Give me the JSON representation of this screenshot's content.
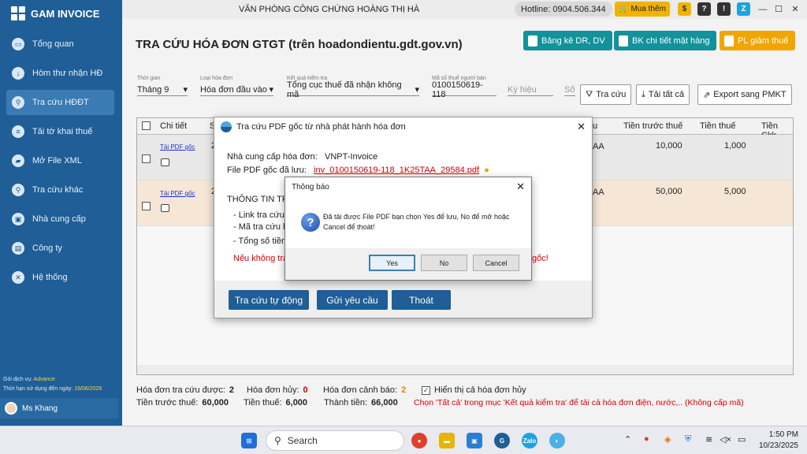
{
  "app": {
    "name": "GAM INVOICE"
  },
  "sidebar": {
    "items": [
      {
        "label": "Tổng quan",
        "icon": "monitor-icon"
      },
      {
        "label": "Hòm thư nhận HĐ",
        "icon": "inbox-icon"
      },
      {
        "label": "Tra cứu HĐĐT",
        "icon": "search-invoice-icon"
      },
      {
        "label": "Tải tờ khai thuế",
        "icon": "tax-form-icon"
      },
      {
        "label": "Mở File XML",
        "icon": "folder-icon"
      },
      {
        "label": "Tra cứu khác",
        "icon": "search-icon"
      },
      {
        "label": "Nhà cung cấp",
        "icon": "supplier-icon"
      },
      {
        "label": "Công ty",
        "icon": "company-icon"
      },
      {
        "label": "Hệ thống",
        "icon": "tools-icon"
      }
    ],
    "plan_label": "Gói dịch vụ:",
    "plan_value": "Advance",
    "expiry_label": "Thời hạn sử dụng đến ngày:",
    "expiry_value": "16/06/2026",
    "user": "Ms Khang"
  },
  "topbar": {
    "office": "VĂN PHÒNG CÔNG CHỨNG HOÀNG THỊ HÀ",
    "hotline": "Hotline: 0904.506.344",
    "buy_more": "Mua thêm"
  },
  "page": {
    "title": "TRA CỨU HÓA ĐƠN GTGT (trên hoadondientu.gdt.gov.vn)",
    "buttons": {
      "bk_dr": "Bảng kê DR, DV",
      "bk_items": "BK chi tiết mặt hàng",
      "pl_tax": "PL giảm thuế"
    }
  },
  "filters": {
    "period_label": "Thời gian",
    "period_value": "Tháng 9",
    "type_label": "Loại hóa đơn",
    "type_value": "Hóa đơn đầu vào",
    "result_label": "Kết quả kiểm tra",
    "result_value": "Tổng cục thuế đã nhận không mã",
    "taxid_label": "Mã số thuế người bán",
    "taxid_value": "0100150619-118",
    "symbol_placeholder": "Ký hiệu",
    "number_placeholder": "Số"
  },
  "tools": {
    "search": "Tra cứu",
    "download_all": "Tải tất cả",
    "export": "Export sang PMKT"
  },
  "table": {
    "headers": [
      "Chi tiết",
      "S",
      "u",
      "Tiền trước thuế",
      "Tiền thuế",
      "Tiền Ckk"
    ],
    "rows": [
      {
        "link": "Tải PDF gốc",
        "col_s": "2",
        "col_u": "AA",
        "pretax": "10,000",
        "tax": "1,000"
      },
      {
        "link": "Tải PDF gốc",
        "col_s": "2",
        "col_u": "AA",
        "pretax": "50,000",
        "tax": "5,000"
      }
    ]
  },
  "summary": {
    "found_label": "Hóa đơn tra cứu được:",
    "found_value": "2",
    "cancelled_label": "Hóa đơn hủy:",
    "cancelled_value": "0",
    "warning_label": "Hóa đơn cảnh báo:",
    "warning_value": "2",
    "show_cancelled": "Hiển thị cả hóa đơn hủy",
    "pretax_label": "Tiền trước thuế:",
    "pretax_value": "60,000",
    "tax_label": "Tiền thuế:",
    "tax_value": "6,000",
    "total_label": "Thành tiền:",
    "total_value": "66,000",
    "note": "Chọn 'Tất cả' trong mục 'Kết quả kiểm tra' để tải cả hóa đơn điện, nước,.. (Không cấp mã)"
  },
  "dialog": {
    "title": "Tra cứu PDF gốc từ nhà phát hành hóa đơn",
    "provider_label": "Nhà cung cấp hóa đơn:",
    "provider_value": "VNPT-Invoice",
    "saved_label": "File PDF gốc đã lưu:",
    "saved_value": "inv_0100150619-118_1K25TAA_29584.pdf",
    "section": "THÔNG TIN TRA",
    "link_label": "- Link tra cứu:",
    "code_label": "- Mã tra cứu hó",
    "total_label": "- Tổng số tiền:",
    "warning_start": "Nếu không tra",
    "warning_end": "gốc!",
    "btn_auto": "Tra cứu tự động",
    "btn_request": "Gửi yêu cầu",
    "btn_exit": "Thoát"
  },
  "message": {
    "title": "Thông báo",
    "text": "Đã tải được File PDF bạn chọn Yes để lưu, No để mở hoặc Cancel để thoát!",
    "yes": "Yes",
    "no": "No",
    "cancel": "Cancel"
  },
  "taskbar": {
    "search": "Search",
    "time": "1:50 PM",
    "date": "10/23/2025"
  },
  "colors": {
    "sidebar": "#1f5e96",
    "teal_button": "#12929a",
    "orange_button": "#f0a500",
    "warning_red": "#d50000"
  }
}
